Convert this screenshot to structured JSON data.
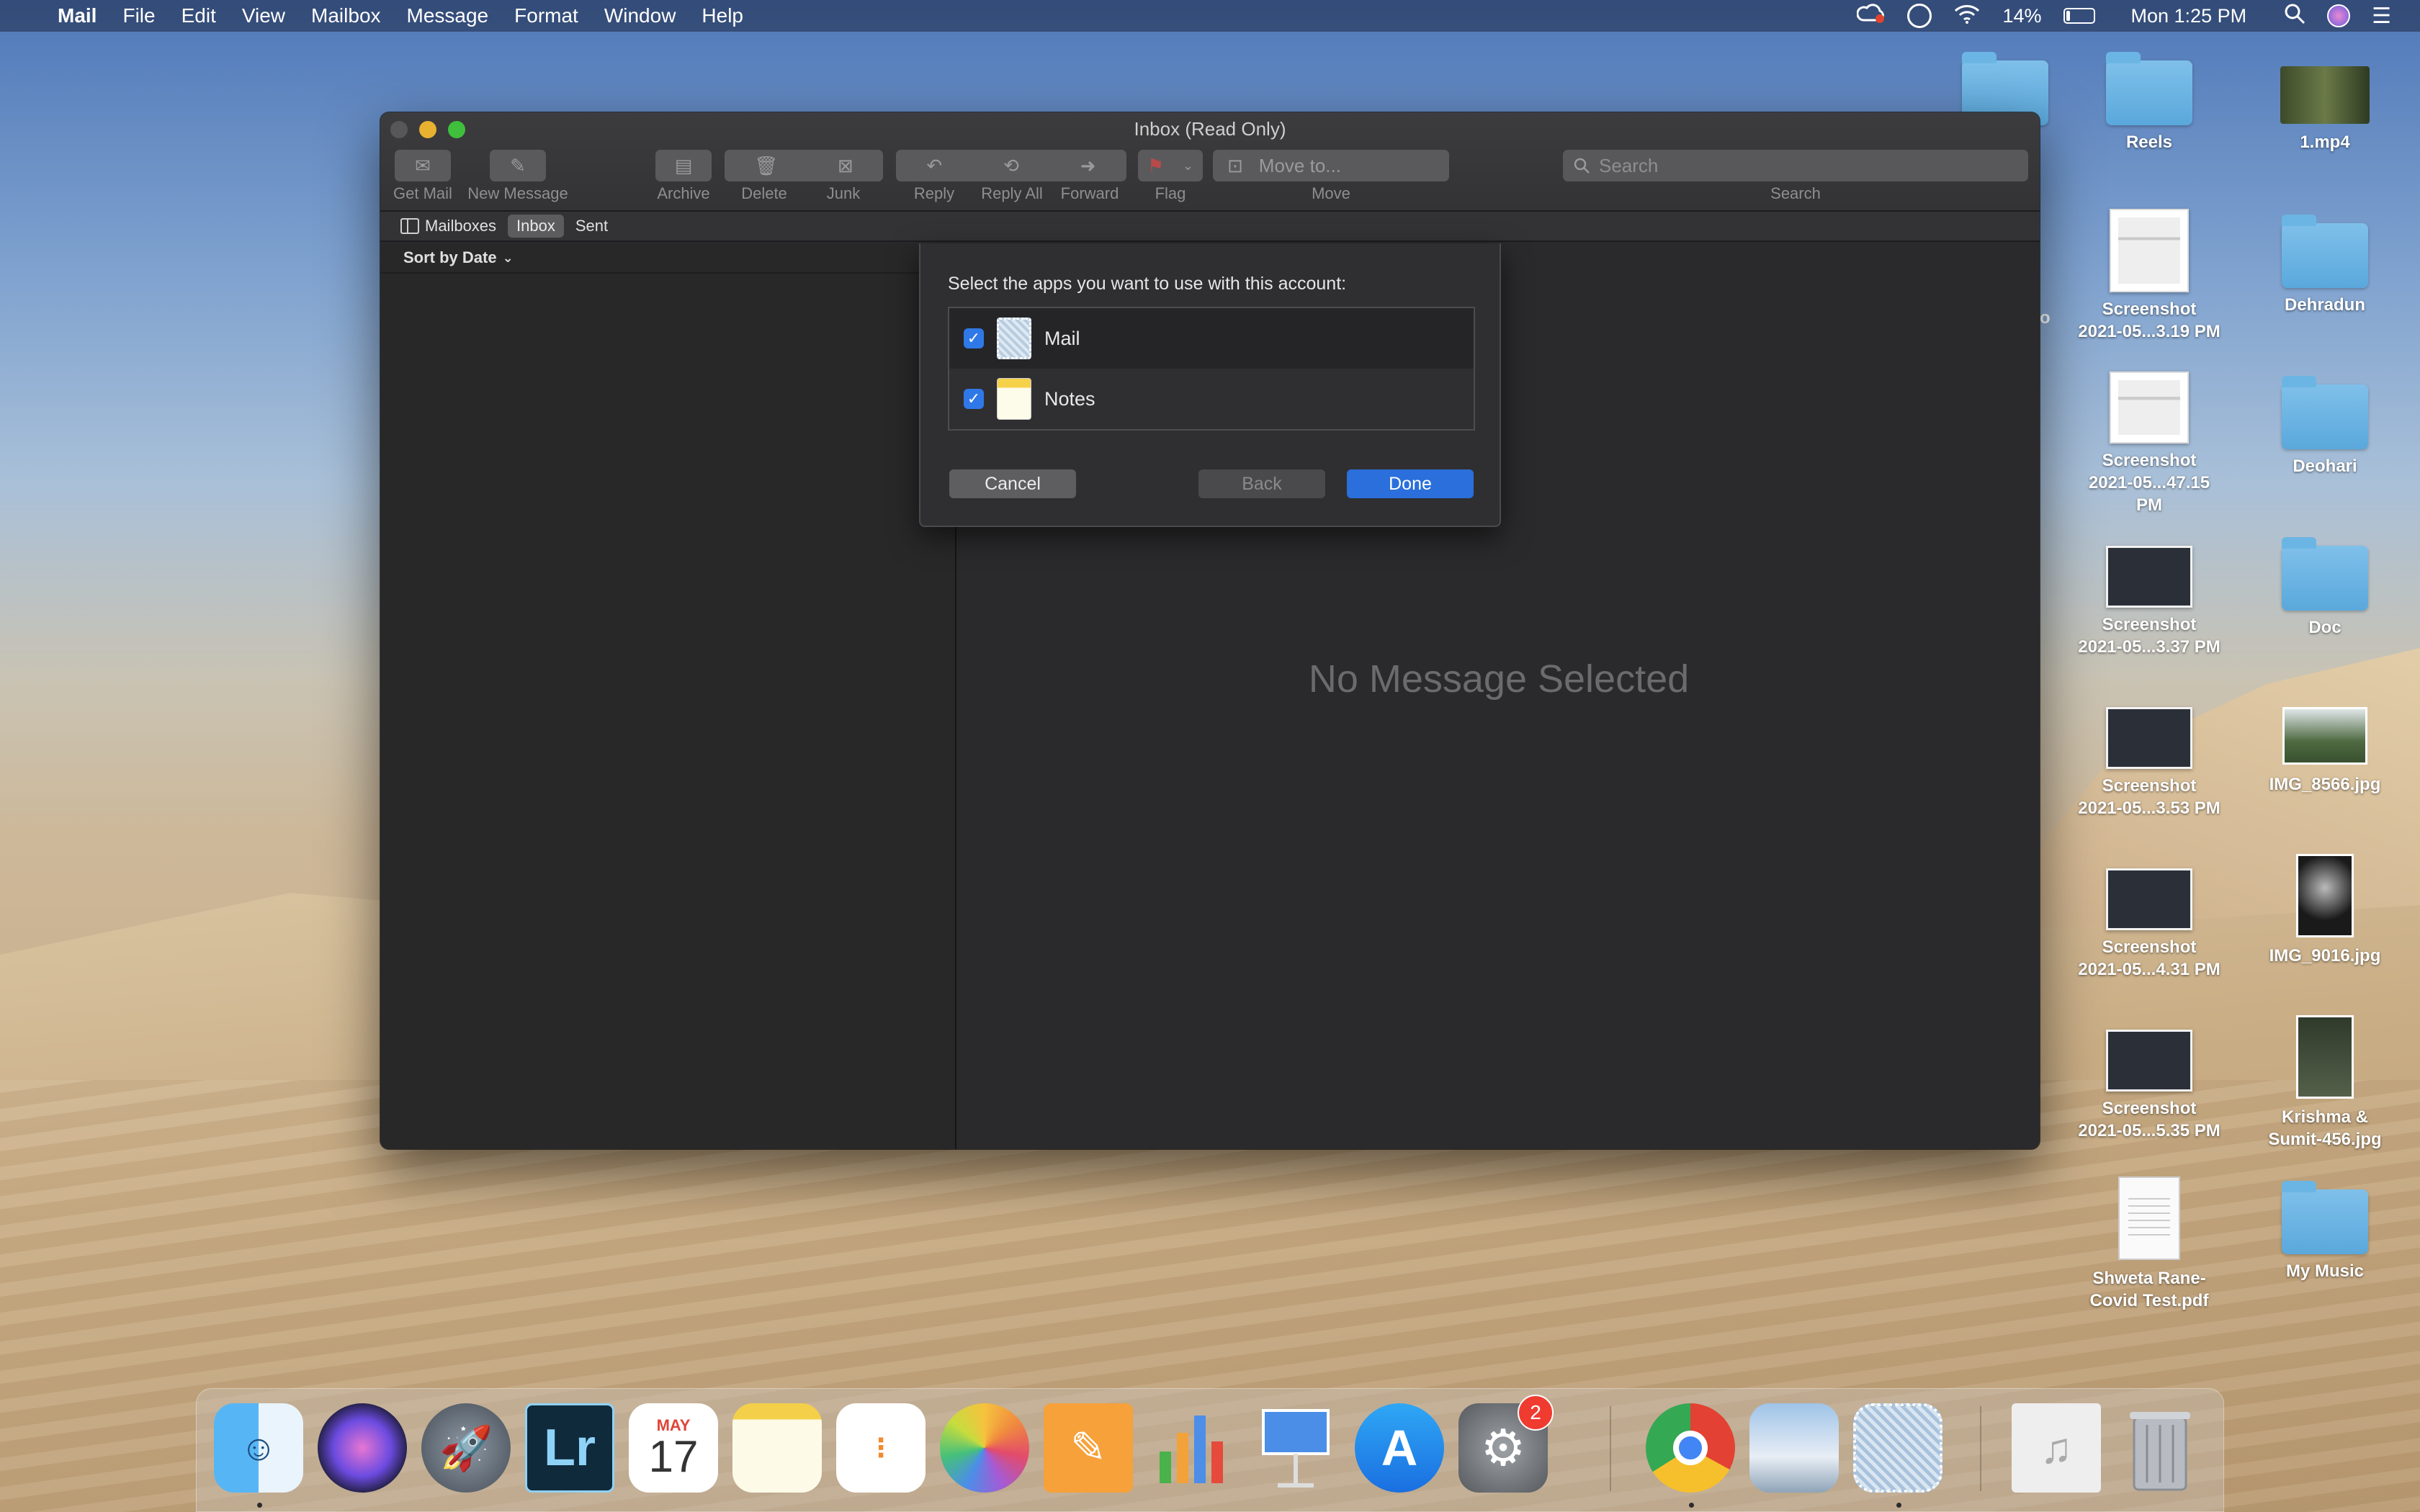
{
  "menubar": {
    "app_name": "Mail",
    "menus": [
      "File",
      "Edit",
      "View",
      "Mailbox",
      "Message",
      "Format",
      "Window",
      "Help"
    ],
    "battery_percent": "14%",
    "battery_level": 0.14,
    "clock": "Mon 1:25 PM",
    "icons": [
      "creative-cloud-icon",
      "vpn-icon",
      "wifi-icon",
      "battery-icon",
      "spotlight-search-icon",
      "siri-icon",
      "control-center-icon"
    ]
  },
  "window": {
    "title": "Inbox (Read Only)",
    "toolbar": {
      "get_mail": "Get Mail",
      "new_message": "New Message",
      "archive": "Archive",
      "delete": "Delete",
      "junk": "Junk",
      "reply": "Reply",
      "reply_all": "Reply All",
      "forward": "Forward",
      "flag": "Flag",
      "move_to": "Move to...",
      "move": "Move",
      "search_placeholder": "Search",
      "search_label": "Search"
    },
    "favorites": {
      "mailboxes": "Mailboxes",
      "inbox": "Inbox",
      "sent": "Sent"
    },
    "sort": "Sort by Date",
    "viewer_empty": "No Message Selected"
  },
  "dialog": {
    "prompt": "Select the apps you want to use with this account:",
    "apps": [
      {
        "name": "Mail",
        "checked": true
      },
      {
        "name": "Notes",
        "checked": true
      }
    ],
    "cancel": "Cancel",
    "back": "Back",
    "done": "Done",
    "accent": "#2a6fdb"
  },
  "desktop": {
    "items": [
      {
        "label": "Reels",
        "kind": "folder"
      },
      {
        "label": "1.mp4",
        "kind": "video"
      },
      {
        "label": "Screenshot\n2021-05...3.19 PM",
        "kind": "screenshot"
      },
      {
        "label": "Dehradun",
        "kind": "folder"
      },
      {
        "label": "Screenshot\n2021-05...47.15 PM",
        "kind": "screenshot"
      },
      {
        "label": "Deohari",
        "kind": "folder"
      },
      {
        "label": "Screenshot\n2021-05...3.37 PM",
        "kind": "screenshot"
      },
      {
        "label": "Doc",
        "kind": "folder"
      },
      {
        "label": "Screenshot\n2021-05...3.53 PM",
        "kind": "screenshot"
      },
      {
        "label": "IMG_8566.jpg",
        "kind": "image"
      },
      {
        "label": "Screenshot\n2021-05...4.31 PM",
        "kind": "screenshot"
      },
      {
        "label": "IMG_9016.jpg",
        "kind": "image"
      },
      {
        "label": "Screenshot\n2021-05...5.35 PM",
        "kind": "screenshot"
      },
      {
        "label": "Krishma &\nSumit-456.jpg",
        "kind": "image"
      },
      {
        "label": "Shweta Rane-\nCovid Test.pdf",
        "kind": "pdf"
      },
      {
        "label": "My Music",
        "kind": "folder"
      }
    ],
    "partial_label": "o"
  },
  "dock": {
    "apps": [
      {
        "name": "finder-icon",
        "running": true
      },
      {
        "name": "siri-icon"
      },
      {
        "name": "launchpad-icon"
      },
      {
        "name": "lightroom-icon",
        "text": "Lr"
      },
      {
        "name": "calendar-icon",
        "month": "MAY",
        "day": "17"
      },
      {
        "name": "notes-icon"
      },
      {
        "name": "reminders-icon"
      },
      {
        "name": "photos-icon"
      },
      {
        "name": "pages-icon"
      },
      {
        "name": "numbers-icon"
      },
      {
        "name": "keynote-icon"
      },
      {
        "name": "app-store-icon"
      },
      {
        "name": "system-preferences-icon",
        "badge": "2"
      },
      {
        "name": "chrome-icon",
        "running": true
      },
      {
        "name": "preview-icon"
      },
      {
        "name": "mail-icon",
        "running": true
      },
      {
        "name": "music-document-icon"
      },
      {
        "name": "trash-icon"
      }
    ]
  }
}
